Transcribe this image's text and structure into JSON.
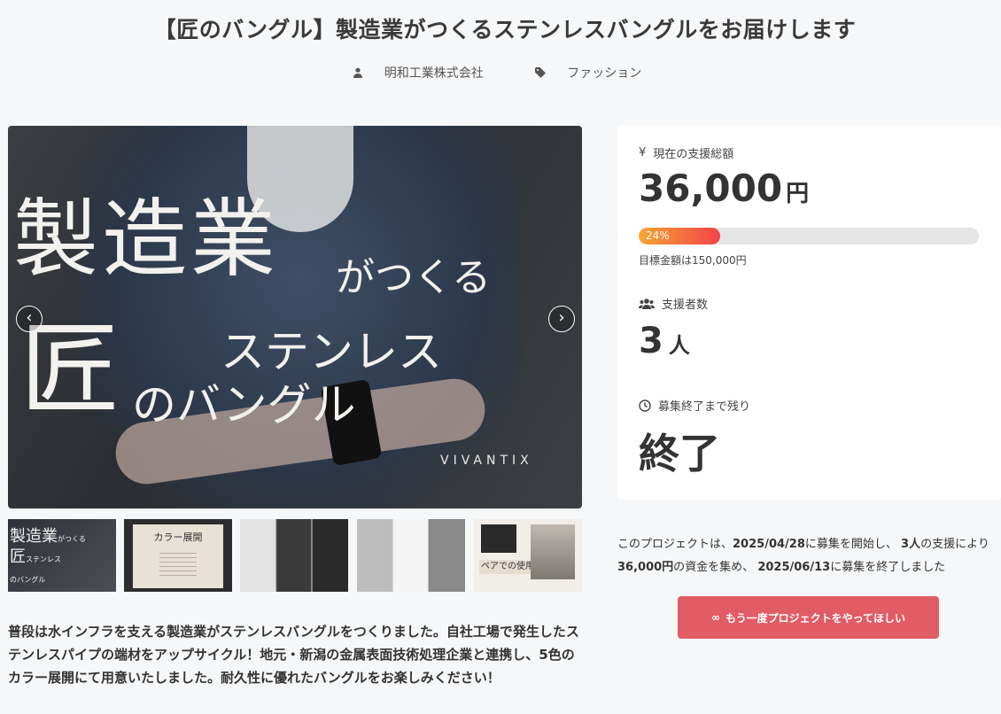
{
  "project": {
    "title": "【匠のバングル】製造業がつくるステンレスバングルをお届けします",
    "company": "明和工業株式会社",
    "category": "ファッション"
  },
  "hero": {
    "text_line1": "製造業",
    "text_line1_small": "がつくる",
    "text_big": "匠",
    "text_stainless": "ステンレス",
    "text_bangle": "のバングル",
    "brand": "VIVANTIX",
    "prev_arrow": "‹",
    "next_arrow": "›"
  },
  "thumbnails": {
    "t1_line1": "製造業",
    "t1_small1": "がつくる",
    "t1_line2": "匠",
    "t1_small2": "ステンレス",
    "t1_small3": "のバングル",
    "t2_label": "カラー展開",
    "t5_label": "ペアでの使用も"
  },
  "description": "普段は水インフラを支える製造業がステンレスバングルをつくりました。自社工場で発生したステンレスパイプの端材をアップサイクル！地元・新潟の金属表面技術処理企業と連携し、5色のカラー展開にて用意いたしました。耐久性に優れたバングルをお楽しみください！",
  "stats": {
    "total_label": "現在の支援総額",
    "total_value": "36,000",
    "total_unit": "円",
    "progress_percent": 24,
    "progress_label": "24%",
    "goal_text": "目標金額は150,000円",
    "supporters_label": "支援者数",
    "supporters_value": "3",
    "supporters_unit": "人",
    "remaining_label": "募集終了まで残り",
    "remaining_value": "終了"
  },
  "summary": {
    "p1": "このプロジェクトは、",
    "start_date": "2025/04/28",
    "p2": "に募集を開始し、",
    "backers": "3人",
    "p3": "の支援により",
    "amount": "36,000円",
    "p4": "の資金を集め、",
    "end_date": "2025/06/13",
    "p5": "に募集を終了しました"
  },
  "button": {
    "icon": "∞",
    "label": "もう一度プロジェクトをやってほしい"
  },
  "colors": {
    "accent": "#e25c65",
    "progress_start": "#f6a632",
    "progress_end": "#f4434a"
  }
}
